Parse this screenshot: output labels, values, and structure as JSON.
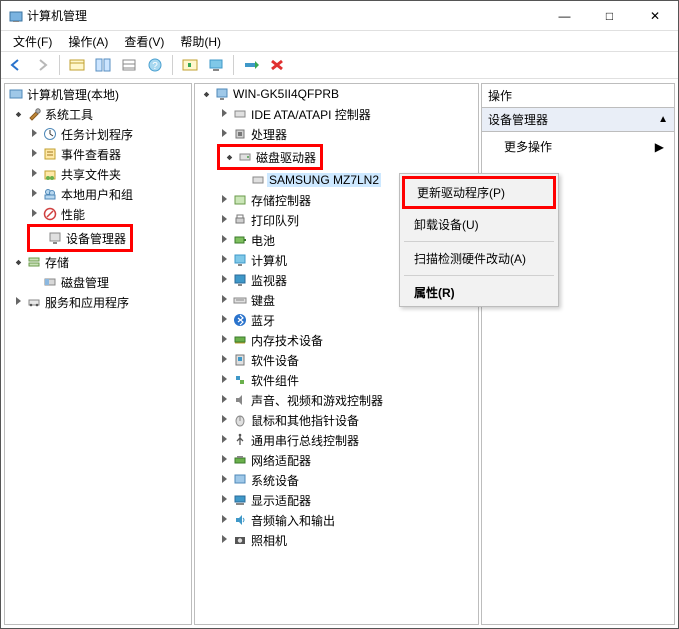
{
  "window": {
    "title": "计算机管理"
  },
  "winbuttons": {
    "minimize": "—",
    "maximize": "□",
    "close": "✕"
  },
  "menu": {
    "file": "文件(F)",
    "action": "操作(A)",
    "view": "查看(V)",
    "help": "帮助(H)"
  },
  "left": {
    "root": "计算机管理(本地)",
    "systools": "系统工具",
    "scheduler": "任务计划程序",
    "eventvwr": "事件查看器",
    "shared": "共享文件夹",
    "localusers": "本地用户和组",
    "perf": "性能",
    "devmgr": "设备管理器",
    "storage": "存储",
    "diskmgmt": "磁盘管理",
    "svcapps": "服务和应用程序"
  },
  "mid": {
    "computer": "WIN-GK5II4QFPRB",
    "ide": "IDE ATA/ATAPI 控制器",
    "cpu": "处理器",
    "diskdrives": "磁盘驱动器",
    "samsung": "SAMSUNG MZ7LN2",
    "storage_ctrl": "存储控制器",
    "printq": "打印队列",
    "battery": "电池",
    "pc": "计算机",
    "monitor": "监视器",
    "keyboard": "键盘",
    "bluetooth": "蓝牙",
    "memtech": "内存技术设备",
    "software": "软件设备",
    "swcomp": "软件组件",
    "audvid": "声音、视频和游戏控制器",
    "mouse": "鼠标和其他指针设备",
    "usb": "通用串行总线控制器",
    "nic": "网络适配器",
    "sysdev": "系统设备",
    "display": "显示适配器",
    "audio": "音频输入和输出",
    "camera": "照相机"
  },
  "ctx": {
    "update": "更新驱动程序(P)",
    "uninstall": "卸载设备(U)",
    "scan": "扫描检测硬件改动(A)",
    "properties": "属性(R)"
  },
  "actions": {
    "title": "操作",
    "section": "设备管理器",
    "more": "更多操作"
  }
}
